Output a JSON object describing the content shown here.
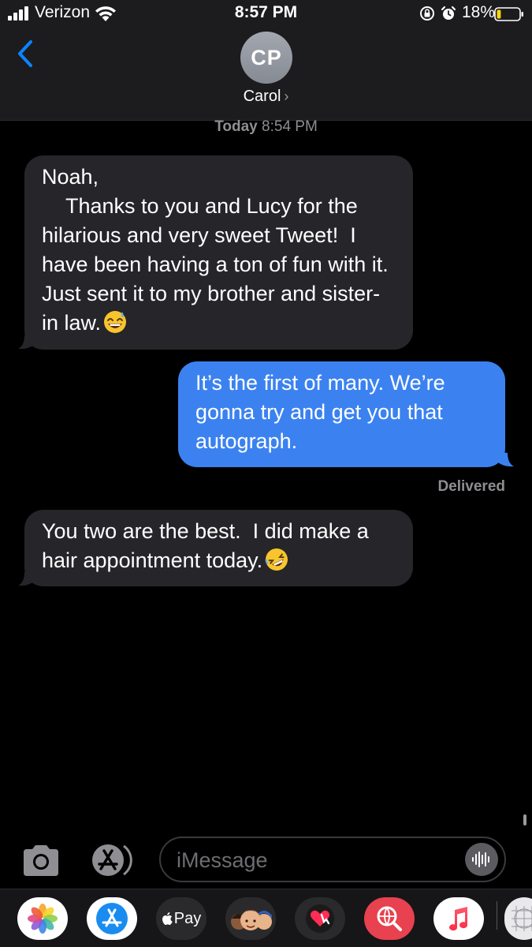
{
  "status_bar": {
    "carrier": "Verizon",
    "time": "8:57 PM",
    "battery_percent": "18%",
    "battery_level": 0.18,
    "icons": [
      "signal-icon",
      "wifi-icon",
      "rotation-lock-icon",
      "alarm-icon",
      "battery-icon"
    ]
  },
  "header": {
    "back_icon": "chevron-left-icon",
    "avatar_initials": "CP",
    "contact_name": "Carol",
    "contact_chevron": "›"
  },
  "conversation": {
    "timestamp_day": "Today",
    "timestamp_time": "8:54 PM",
    "messages": [
      {
        "direction": "incoming",
        "text": "Noah,\n    Thanks to you and Lucy for the hilarious and very sweet Tweet!  I have been having a ton of fun with it.  Just sent it to my brother and sister-in law.",
        "emoji": "grinning-sweat-emoji"
      },
      {
        "direction": "outgoing",
        "text": "It’s the first of many. We’re gonna try and get you that autograph."
      },
      {
        "direction": "incoming",
        "text": "You two are the best.  I did make a hair appointment today.",
        "emoji": "rolling-laughing-emoji"
      }
    ],
    "delivered_label": "Delivered"
  },
  "input_bar": {
    "placeholder": "iMessage",
    "value": "",
    "camera_icon": "camera-icon",
    "apps_icon": "app-store-icon",
    "audio_icon": "audio-waveform-icon"
  },
  "app_drawer": {
    "apps": [
      {
        "name": "photos",
        "icon": "photos-icon"
      },
      {
        "name": "app-store",
        "icon": "app-store-icon"
      },
      {
        "name": "apple-pay",
        "icon": "apple-pay-icon",
        "label": "Pay",
        "logo": ""
      },
      {
        "name": "memoji",
        "icon": "memoji-icon"
      },
      {
        "name": "digital-touch",
        "icon": "digital-touch-icon"
      },
      {
        "name": "images-search",
        "icon": "web-search-icon"
      },
      {
        "name": "music",
        "icon": "music-icon"
      },
      {
        "name": "more",
        "icon": "more-apps-icon"
      }
    ]
  },
  "colors": {
    "background": "#000000",
    "header": "#1c1c1e",
    "incoming_bubble": "#26252a",
    "outgoing_bubble": "#3b82f0",
    "ios_blue": "#0a84ff",
    "battery_low": "#ffd60a",
    "secondary_text": "#8e8e93"
  }
}
